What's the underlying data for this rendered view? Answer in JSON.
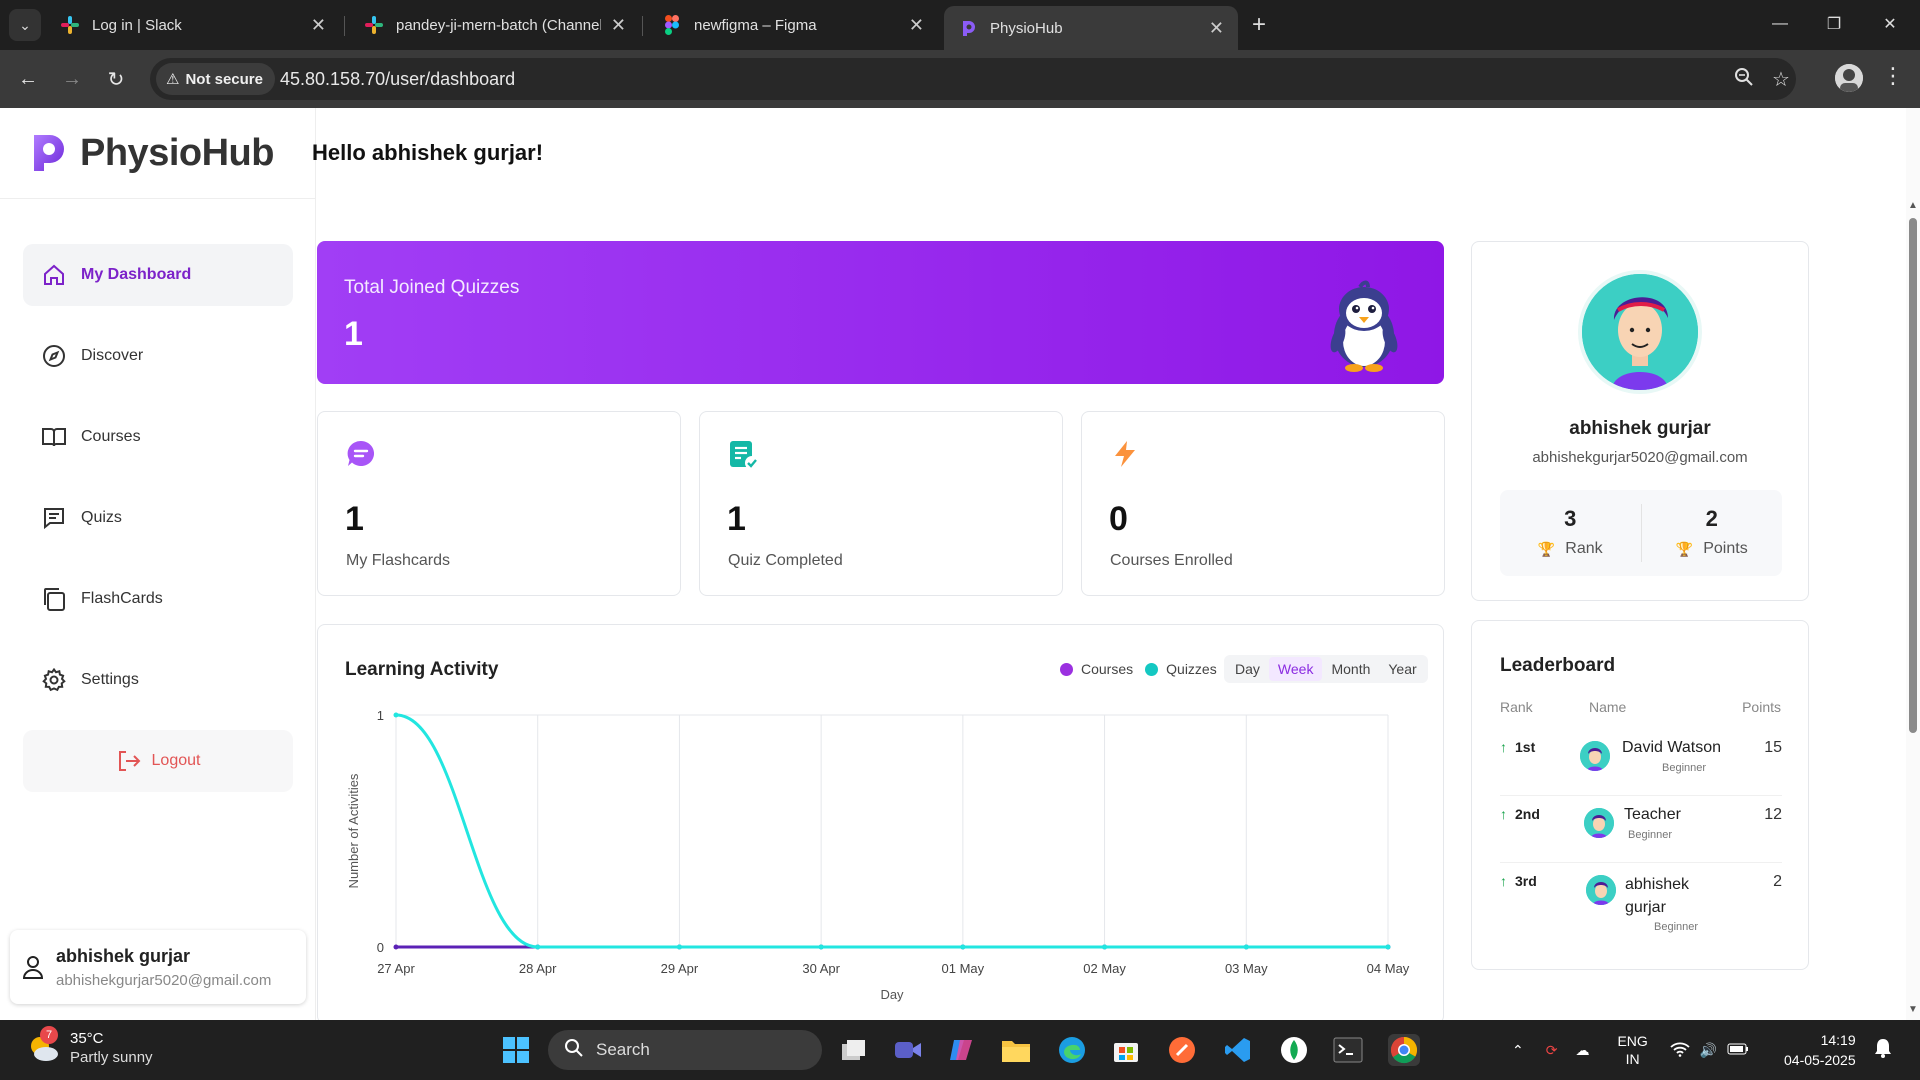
{
  "browser": {
    "tabs": [
      {
        "title": "Log in | Slack",
        "favicon": "slack-icon",
        "active": false
      },
      {
        "title": "pandey-ji-mern-batch (Channel",
        "favicon": "slack-icon",
        "active": false
      },
      {
        "title": "newfigma – Figma",
        "favicon": "figma-icon",
        "active": false
      },
      {
        "title": "PhysioHub",
        "favicon": "physiohub-icon",
        "active": true
      }
    ],
    "security_label": "Not secure",
    "url": "45.80.158.70/user/dashboard"
  },
  "app": {
    "brand": "PhysioHub",
    "accent_color": "#8f17e6",
    "greeting": "Hello abhishek gurjar!",
    "nav": [
      {
        "label": "My Dashboard",
        "icon": "home-icon",
        "active": true
      },
      {
        "label": "Discover",
        "icon": "compass-icon",
        "active": false
      },
      {
        "label": "Courses",
        "icon": "book-icon",
        "active": false
      },
      {
        "label": "Quizs",
        "icon": "message-square-icon",
        "active": false
      },
      {
        "label": "FlashCards",
        "icon": "cards-icon",
        "active": false
      },
      {
        "label": "Settings",
        "icon": "gear-icon",
        "active": false
      }
    ],
    "logout_label": "Logout",
    "user": {
      "name": "abhishek gurjar",
      "email": "abhishekgurjar5020@gmail.com"
    },
    "hero": {
      "label": "Total Joined Quizzes",
      "value": "1"
    },
    "stats": [
      {
        "value": "1",
        "label": "My Flashcards",
        "icon": "chat-bubble-icon"
      },
      {
        "value": "1",
        "label": "Quiz Completed",
        "icon": "checklist-icon"
      },
      {
        "value": "0",
        "label": "Courses Enrolled",
        "icon": "lightning-icon"
      }
    ],
    "activity": {
      "title": "Learning Activity",
      "legend": [
        {
          "label": "Courses",
          "color": "#9b30e0"
        },
        {
          "label": "Quizzes",
          "color": "#14c8c2"
        }
      ],
      "ranges": [
        "Day",
        "Week",
        "Month",
        "Year"
      ],
      "selected_range": "Week"
    },
    "profile": {
      "name": "abhishek gurjar",
      "email": "abhishekgurjar5020@gmail.com",
      "rank_value": "3",
      "rank_label": "Rank",
      "points_value": "2",
      "points_label": "Points"
    },
    "leaderboard": {
      "title": "Leaderboard",
      "headers": {
        "rank": "Rank",
        "name": "Name",
        "points": "Points"
      },
      "rows": [
        {
          "rank": "1st",
          "name": "David Watson",
          "level": "Beginner",
          "points": "15"
        },
        {
          "rank": "2nd",
          "name": "Teacher",
          "level": "Beginner",
          "points": "12"
        },
        {
          "rank": "3rd",
          "name": "abhishek gurjar",
          "level": "Beginner",
          "points": "2"
        }
      ]
    }
  },
  "chart_data": {
    "type": "line",
    "title": "",
    "xlabel": "Day",
    "ylabel": "Number of Activities",
    "x": [
      "27 Apr",
      "28 Apr",
      "29 Apr",
      "30 Apr",
      "01 May",
      "02 May",
      "03 May",
      "04 May"
    ],
    "ylim": [
      0,
      1
    ],
    "yticks": [
      "0",
      "1"
    ],
    "series": [
      {
        "name": "Courses",
        "color": "#5b21b6",
        "values": [
          0,
          0,
          0,
          0,
          0,
          0,
          0,
          0
        ]
      },
      {
        "name": "Quizzes",
        "color": "#22e6e0",
        "values": [
          1,
          0,
          0,
          0,
          0,
          0,
          0,
          0
        ]
      }
    ],
    "grid": true,
    "legend": "top-right"
  },
  "taskbar": {
    "weather_badge": "7",
    "temperature": "35°C",
    "condition": "Partly sunny",
    "search_label": "Search",
    "language": "ENG",
    "region": "IN",
    "time": "14:19",
    "date": "04-05-2025"
  }
}
